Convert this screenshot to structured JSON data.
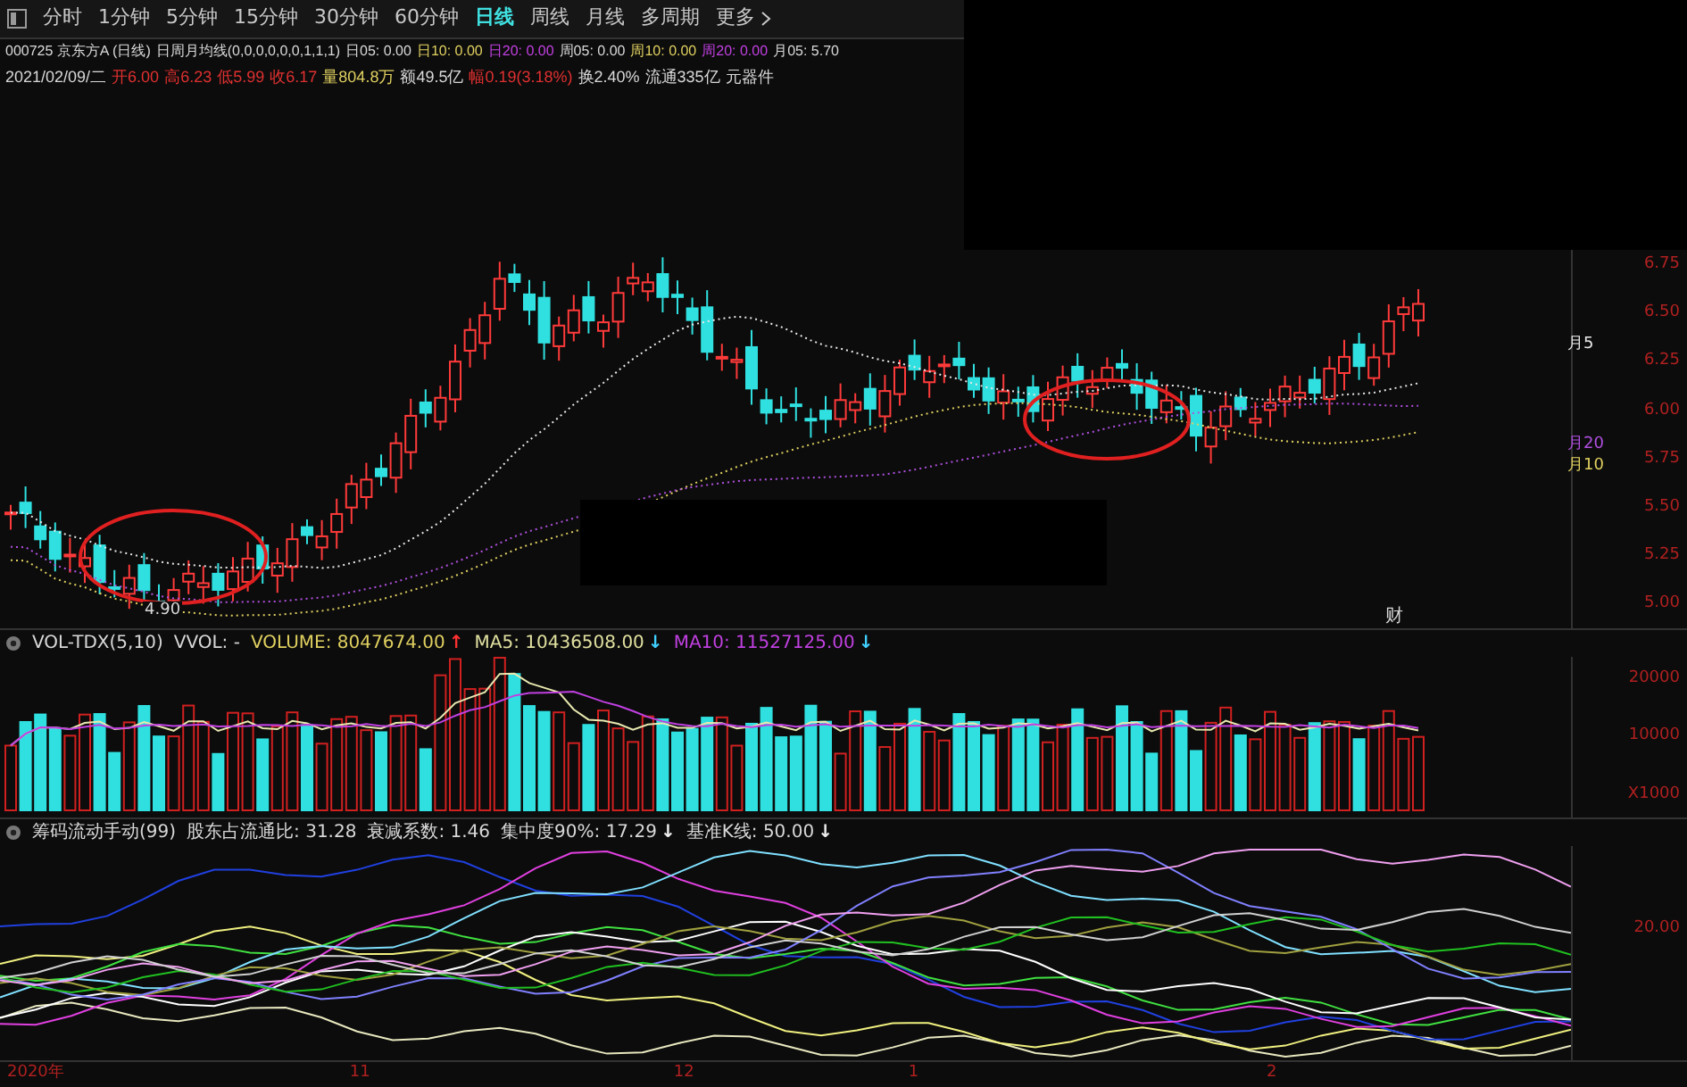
{
  "toolbar": {
    "tabs": [
      {
        "label": "分时",
        "selected": false
      },
      {
        "label": "1分钟",
        "selected": false
      },
      {
        "label": "5分钟",
        "selected": false
      },
      {
        "label": "15分钟",
        "selected": false
      },
      {
        "label": "30分钟",
        "selected": false
      },
      {
        "label": "60分钟",
        "selected": false
      },
      {
        "label": "日线",
        "selected": true
      },
      {
        "label": "周线",
        "selected": false
      },
      {
        "label": "月线",
        "selected": false
      },
      {
        "label": "多周期",
        "selected": false
      },
      {
        "label": "更多",
        "selected": false
      }
    ]
  },
  "info_line_1": [
    {
      "text": "000725 京东方A (日线)",
      "color": "#d8d8d8"
    },
    {
      "text": "日周月均线(0,0,0,0,0,0,1,1,1)",
      "color": "#d8d8d8"
    },
    {
      "text": "日05: 0.00",
      "color": "#d8d8d8"
    },
    {
      "text": "日10: 0.00",
      "color": "#e0d060"
    },
    {
      "text": "日20: 0.00",
      "color": "#c040e0"
    },
    {
      "text": "周05: 0.00",
      "color": "#d8d8d8"
    },
    {
      "text": "周10: 0.00",
      "color": "#e0d060"
    },
    {
      "text": "周20: 0.00",
      "color": "#c040e0"
    },
    {
      "text": "月05: 5.70",
      "color": "#d8d8d8"
    }
  ],
  "info_line_2": [
    {
      "text": "2021/02/09/二",
      "color": "#d8d8d8"
    },
    {
      "text": "开6.00",
      "color": "#e03030"
    },
    {
      "text": "高6.23",
      "color": "#e03030"
    },
    {
      "text": "低5.99",
      "color": "#e03030"
    },
    {
      "text": "收6.17",
      "color": "#e03030"
    },
    {
      "text": "量804.8万",
      "color": "#e0d060"
    },
    {
      "text": "额49.5亿",
      "color": "#d8d8d8"
    },
    {
      "text": "幅0.19(3.18%)",
      "color": "#e03030"
    },
    {
      "text": "换2.40%",
      "color": "#d8d8d8"
    },
    {
      "text": "流通335亿",
      "color": "#d8d8d8"
    },
    {
      "text": "元器件",
      "color": "#d8d8d8"
    }
  ],
  "price_chart": {
    "low_label": "4.90",
    "event_marker": "财",
    "ma_labels": [
      {
        "text": "月5",
        "color": "#e8e8e8"
      },
      {
        "text": "月20",
        "color": "#b050e0"
      },
      {
        "text": "月10",
        "color": "#e0d060"
      }
    ],
    "yticks": [
      "6.75",
      "6.50",
      "6.25",
      "6.00",
      "5.75",
      "5.50",
      "5.25",
      "5.00"
    ]
  },
  "volume_panel": {
    "header": [
      {
        "text": "VOL-TDX(5,10)",
        "color": "#d8d8d8"
      },
      {
        "text": "VVOL: -",
        "color": "#d8d8d8"
      },
      {
        "text": "VOLUME: 8047674.00",
        "color": "#e0d060",
        "arrow": {
          "text": "↑",
          "color": "#ff3030"
        }
      },
      {
        "text": "MA5: 10436508.00",
        "color": "#e0e0a0",
        "arrow": {
          "text": "↓",
          "color": "#40d0ff"
        }
      },
      {
        "text": "MA10: 11527125.00",
        "color": "#c040e0",
        "arrow": {
          "text": "↓",
          "color": "#40d0ff"
        }
      }
    ],
    "yticks": [
      "20000",
      "10000",
      "X1000"
    ]
  },
  "chip_panel": {
    "header": [
      {
        "text": "筹码流动手动(99)",
        "color": "#d8d8d8"
      },
      {
        "text": "股东占流通比: 31.28",
        "color": "#d8d8d8"
      },
      {
        "text": "衰减系数: 1.46",
        "color": "#d8d8d8"
      },
      {
        "text": "集中度90%: 17.29",
        "color": "#d8d8d8",
        "arrow": {
          "text": "↓",
          "color": "#f0f0f0"
        }
      },
      {
        "text": "基准K线: 50.00",
        "color": "#d8d8d8",
        "arrow": {
          "text": "↓",
          "color": "#f0f0f0"
        }
      }
    ],
    "yticks": [
      "20.00"
    ]
  },
  "date_axis": [
    "2020年",
    "11",
    "12",
    "1",
    "2"
  ]
}
